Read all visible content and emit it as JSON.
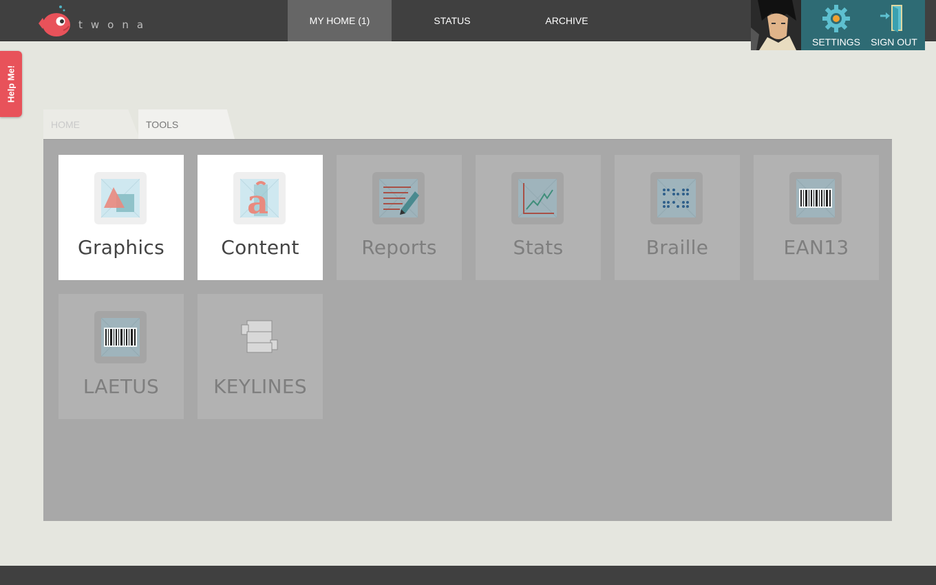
{
  "brand": {
    "name": "twona"
  },
  "nav": {
    "items": [
      {
        "label": "MY HOME (1)",
        "active": true
      },
      {
        "label": "STATUS",
        "active": false
      },
      {
        "label": "ARCHIVE",
        "active": false
      }
    ]
  },
  "user": {
    "settings_label": "SETTINGS",
    "signout_label": "SIGN OUT"
  },
  "help": {
    "label": "Help Me!"
  },
  "breadcrumb": [
    {
      "label": "HOME"
    },
    {
      "label": "TOOLS"
    }
  ],
  "tools": [
    {
      "label": "Graphics",
      "icon": "graphics-icon",
      "enabled": true
    },
    {
      "label": "Content",
      "icon": "content-icon",
      "enabled": true
    },
    {
      "label": "Reports",
      "icon": "reports-icon",
      "enabled": false
    },
    {
      "label": "Stats",
      "icon": "stats-icon",
      "enabled": false
    },
    {
      "label": "Braille",
      "icon": "braille-icon",
      "enabled": false
    },
    {
      "label": "EAN13",
      "icon": "barcode-icon",
      "enabled": false
    },
    {
      "label": "LAETUS",
      "icon": "barcode-icon",
      "enabled": false
    },
    {
      "label": "KEYLINES",
      "icon": "keylines-icon",
      "enabled": false
    }
  ],
  "colors": {
    "topbar": "#404040",
    "accent_teal": "#2e6b74",
    "help_red": "#e8525a",
    "tile_enabled": "#ffffff",
    "tile_disabled": "#b2b2b2"
  }
}
